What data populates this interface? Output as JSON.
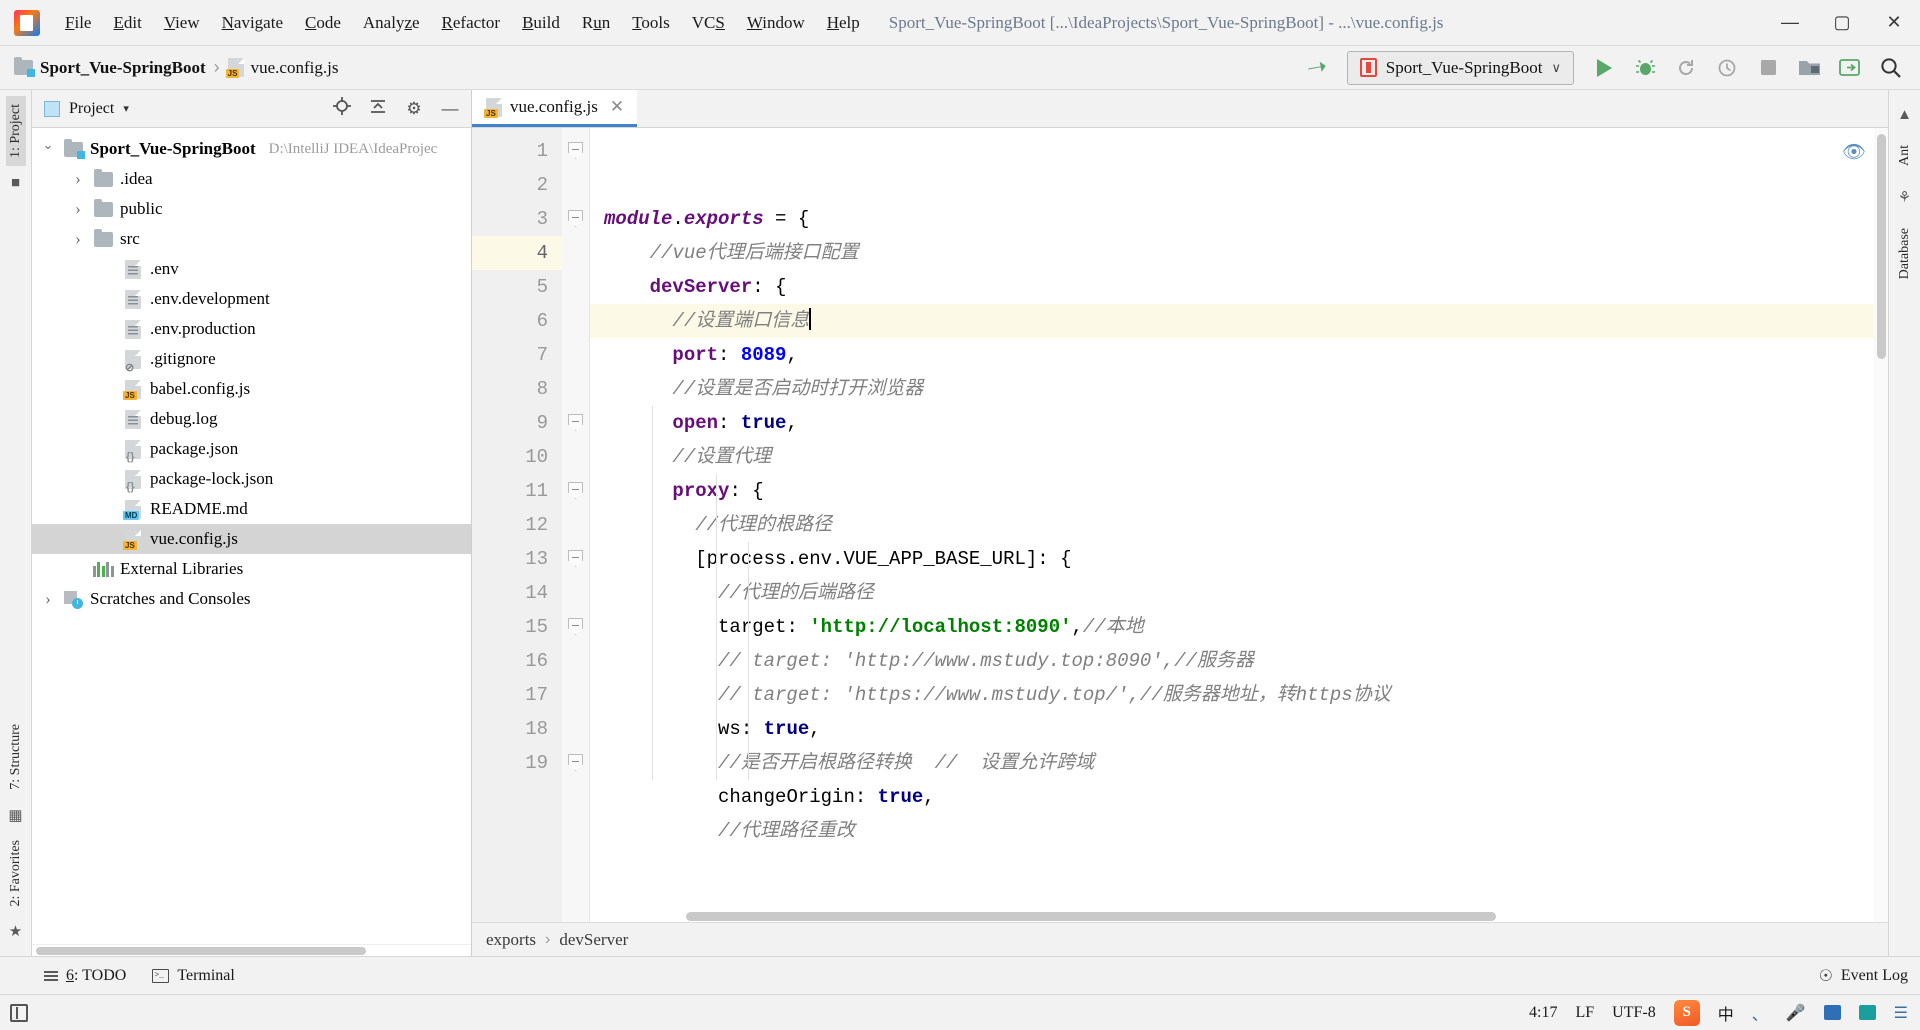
{
  "window": {
    "title": "Sport_Vue-SpringBoot [...\\IdeaProjects\\Sport_Vue-SpringBoot] - ...\\vue.config.js",
    "minimize": "—",
    "maximize": "▢",
    "close": "✕",
    "logo_letters": "IJ"
  },
  "menubar": [
    {
      "pre": "",
      "mn": "F",
      "post": "ile"
    },
    {
      "pre": "",
      "mn": "E",
      "post": "dit"
    },
    {
      "pre": "",
      "mn": "V",
      "post": "iew"
    },
    {
      "pre": "",
      "mn": "N",
      "post": "avigate"
    },
    {
      "pre": "",
      "mn": "C",
      "post": "ode"
    },
    {
      "pre": "Analy",
      "mn": "z",
      "post": "e"
    },
    {
      "pre": "",
      "mn": "R",
      "post": "efactor"
    },
    {
      "pre": "",
      "mn": "B",
      "post": "uild"
    },
    {
      "pre": "R",
      "mn": "u",
      "post": "n"
    },
    {
      "pre": "",
      "mn": "T",
      "post": "ools"
    },
    {
      "pre": "VC",
      "mn": "S",
      "post": ""
    },
    {
      "pre": "",
      "mn": "W",
      "post": "indow"
    },
    {
      "pre": "",
      "mn": "H",
      "post": "elp"
    }
  ],
  "navbar": {
    "crumb_project": "Sport_Vue-SpringBoot",
    "crumb_sep": "›",
    "crumb_file": "vue.config.js",
    "run_config": "Sport_Vue-SpringBoot",
    "run_chevron": "∨",
    "icons": {
      "build": "build-hammer-icon",
      "run": "run-icon",
      "debug": "debug-icon",
      "rerun": "rerun-icon",
      "profile": "profile-icon",
      "stop": "stop-icon",
      "open_project": "open-project-icon",
      "update": "update-icon",
      "search": "search-everywhere-icon"
    }
  },
  "left_rail": {
    "project_tab": "1: Project",
    "structure_tab": "7: Structure",
    "favorites_tab": "2: Favorites"
  },
  "right_rail": {
    "ant_tab": "Ant",
    "database_tab": "Database"
  },
  "project_panel": {
    "title": "Project",
    "caret": "▾",
    "tools": [
      "locate-icon",
      "collapse-all-icon",
      "settings-gear-icon",
      "hide-icon"
    ],
    "tree": [
      {
        "indent": 0,
        "twisty": "open",
        "icon": "module-folder",
        "name": "Sport_Vue-SpringBoot",
        "hint": "D:\\IntelliJ IDEA\\IdeaProjec",
        "bold": true,
        "selected": false
      },
      {
        "indent": 1,
        "twisty": "closed",
        "icon": "folder",
        "name": ".idea",
        "hint": "",
        "bold": false,
        "selected": false
      },
      {
        "indent": 1,
        "twisty": "closed",
        "icon": "folder",
        "name": "public",
        "hint": "",
        "bold": false,
        "selected": false
      },
      {
        "indent": 1,
        "twisty": "closed",
        "icon": "folder",
        "name": "src",
        "hint": "",
        "bold": false,
        "selected": false
      },
      {
        "indent": 2,
        "twisty": "none",
        "icon": "plain-file",
        "name": ".env",
        "hint": "",
        "bold": false,
        "selected": false
      },
      {
        "indent": 2,
        "twisty": "none",
        "icon": "plain-file",
        "name": ".env.development",
        "hint": "",
        "bold": false,
        "selected": false
      },
      {
        "indent": 2,
        "twisty": "none",
        "icon": "plain-file",
        "name": ".env.production",
        "hint": "",
        "bold": false,
        "selected": false
      },
      {
        "indent": 2,
        "twisty": "none",
        "icon": "gitignore-file",
        "name": ".gitignore",
        "hint": "",
        "bold": false,
        "selected": false
      },
      {
        "indent": 2,
        "twisty": "none",
        "icon": "js-file",
        "name": "babel.config.js",
        "hint": "",
        "bold": false,
        "selected": false
      },
      {
        "indent": 2,
        "twisty": "none",
        "icon": "plain-file",
        "name": "debug.log",
        "hint": "",
        "bold": false,
        "selected": false
      },
      {
        "indent": 2,
        "twisty": "none",
        "icon": "json-file",
        "name": "package.json",
        "hint": "",
        "bold": false,
        "selected": false
      },
      {
        "indent": 2,
        "twisty": "none",
        "icon": "json-file",
        "name": "package-lock.json",
        "hint": "",
        "bold": false,
        "selected": false
      },
      {
        "indent": 2,
        "twisty": "none",
        "icon": "md-file",
        "name": "README.md",
        "hint": "",
        "bold": false,
        "selected": false
      },
      {
        "indent": 2,
        "twisty": "none",
        "icon": "js-file",
        "name": "vue.config.js",
        "hint": "",
        "bold": false,
        "selected": true
      },
      {
        "indent": 1,
        "twisty": "none",
        "icon": "libraries",
        "name": "External Libraries",
        "hint": "",
        "bold": false,
        "selected": false
      },
      {
        "indent": 0,
        "twisty": "closed",
        "icon": "scratches",
        "name": "Scratches and Consoles",
        "hint": "",
        "bold": false,
        "selected": false
      }
    ]
  },
  "editor": {
    "tab_label": "vue.config.js",
    "tab_close": "✕",
    "current_line": 4,
    "first_visible_line": 1,
    "lines": [
      {
        "n": 1,
        "fold": true,
        "tokens": [
          {
            "t": "module",
            "c": "mod"
          },
          {
            "t": ".",
            "c": "punc"
          },
          {
            "t": "exports",
            "c": "mod"
          },
          {
            "t": " = {",
            "c": "punc"
          }
        ]
      },
      {
        "n": 2,
        "fold": false,
        "tokens": [
          {
            "t": "    //vue代理后端接口配置",
            "c": "cmt"
          }
        ]
      },
      {
        "n": 3,
        "fold": true,
        "tokens": [
          {
            "t": "    ",
            "c": "punc"
          },
          {
            "t": "devServer",
            "c": "prop"
          },
          {
            "t": ": {",
            "c": "punc"
          }
        ]
      },
      {
        "n": 4,
        "fold": false,
        "tokens": [
          {
            "t": "      //设置端口信息",
            "c": "cmt"
          },
          {
            "t": "CARET",
            "c": "caret"
          }
        ]
      },
      {
        "n": 5,
        "fold": false,
        "tokens": [
          {
            "t": "      ",
            "c": "punc"
          },
          {
            "t": "port",
            "c": "prop"
          },
          {
            "t": ": ",
            "c": "punc"
          },
          {
            "t": "8089",
            "c": "num"
          },
          {
            "t": ",",
            "c": "punc"
          }
        ]
      },
      {
        "n": 6,
        "fold": false,
        "tokens": [
          {
            "t": "      //设置是否启动时打开浏览器",
            "c": "cmt"
          }
        ]
      },
      {
        "n": 7,
        "fold": false,
        "tokens": [
          {
            "t": "      ",
            "c": "punc"
          },
          {
            "t": "open",
            "c": "prop"
          },
          {
            "t": ": ",
            "c": "punc"
          },
          {
            "t": "true",
            "c": "kw"
          },
          {
            "t": ",",
            "c": "punc"
          }
        ]
      },
      {
        "n": 8,
        "fold": false,
        "tokens": [
          {
            "t": "      //设置代理",
            "c": "cmt"
          }
        ]
      },
      {
        "n": 9,
        "fold": true,
        "tokens": [
          {
            "t": "      ",
            "c": "punc"
          },
          {
            "t": "proxy",
            "c": "prop"
          },
          {
            "t": ": {",
            "c": "punc"
          }
        ]
      },
      {
        "n": 10,
        "fold": false,
        "tokens": [
          {
            "t": "        //代理的根路径",
            "c": "cmt"
          }
        ]
      },
      {
        "n": 11,
        "fold": true,
        "tokens": [
          {
            "t": "        [process.env.VUE_APP_BASE_URL]: {",
            "c": "punc"
          }
        ]
      },
      {
        "n": 12,
        "fold": false,
        "tokens": [
          {
            "t": "          //代理的后端路径",
            "c": "cmt"
          }
        ]
      },
      {
        "n": 13,
        "fold": true,
        "tokens": [
          {
            "t": "          ",
            "c": "punc"
          },
          {
            "t": "target",
            "c": "punc"
          },
          {
            "t": ": ",
            "c": "punc"
          },
          {
            "t": "'http://localhost:8090'",
            "c": "str"
          },
          {
            "t": ",",
            "c": "punc"
          },
          {
            "t": "//本地",
            "c": "cmt"
          }
        ]
      },
      {
        "n": 14,
        "fold": false,
        "tokens": [
          {
            "t": "          // target: 'http://www.mstudy.top:8090',//服务器",
            "c": "cmt"
          }
        ]
      },
      {
        "n": 15,
        "fold": true,
        "tokens": [
          {
            "t": "          // target: 'https://www.mstudy.top/',//服务器地址，转https协议",
            "c": "cmt"
          }
        ]
      },
      {
        "n": 16,
        "fold": false,
        "tokens": [
          {
            "t": "          ",
            "c": "punc"
          },
          {
            "t": "ws",
            "c": "punc"
          },
          {
            "t": ": ",
            "c": "punc"
          },
          {
            "t": "true",
            "c": "kw"
          },
          {
            "t": ",",
            "c": "punc"
          }
        ]
      },
      {
        "n": 17,
        "fold": false,
        "tokens": [
          {
            "t": "          //是否开启根路径转换  //  设置允许跨域",
            "c": "cmt"
          }
        ]
      },
      {
        "n": 18,
        "fold": false,
        "tokens": [
          {
            "t": "          ",
            "c": "punc"
          },
          {
            "t": "changeOrigin",
            "c": "punc"
          },
          {
            "t": ": ",
            "c": "punc"
          },
          {
            "t": "true",
            "c": "kw"
          },
          {
            "t": ",",
            "c": "punc"
          }
        ]
      },
      {
        "n": 19,
        "fold": true,
        "tokens": [
          {
            "t": "          //代理路径重改",
            "c": "cmt"
          }
        ]
      }
    ],
    "breadcrumbs": [
      "exports",
      "devServer"
    ],
    "breadcrumb_sep": "›",
    "inspection_icon": "inspection-eye-icon"
  },
  "tool_window_bar": {
    "todo": {
      "pre": "",
      "mn": "6",
      "post": ": TODO"
    },
    "terminal": {
      "pre": "",
      "mn": "",
      "post": "Terminal"
    },
    "event_log": "Event Log"
  },
  "statusbar": {
    "caret_position": "4:17",
    "line_separator": "LF",
    "encoding": "UTF-8",
    "ime_lang": "中",
    "tray": [
      "sogou-icon",
      "lang-icon",
      "mic-icon",
      "keyboard-icon",
      "tools-icon",
      "menu-icon"
    ]
  },
  "colors": {
    "accent_blue": "#4083c9",
    "run_green": "#59a869",
    "caret_line": "#fcf9e6",
    "selection_gray": "#d4d4d4",
    "string_green": "#008000",
    "keyword_navy": "#000080",
    "property_purple": "#660e7a",
    "number_blue": "#0000ff",
    "comment_gray": "#808080"
  }
}
